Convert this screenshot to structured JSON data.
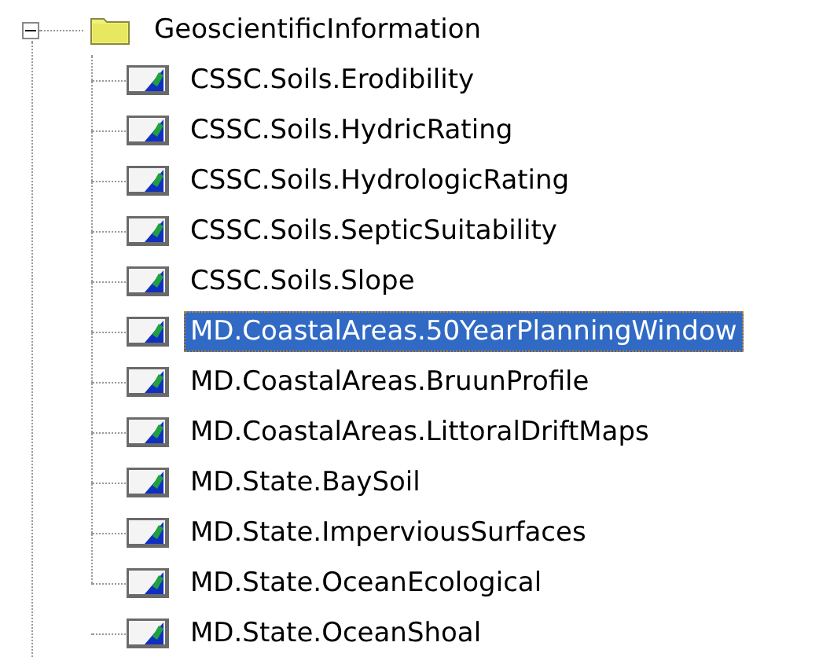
{
  "tree": {
    "label": "GeoscientificInformation",
    "expanded": true,
    "children": [
      {
        "label": "CSSC.Soils.Erodibility",
        "selected": false
      },
      {
        "label": "CSSC.Soils.HydricRating",
        "selected": false
      },
      {
        "label": "CSSC.Soils.HydrologicRating",
        "selected": false
      },
      {
        "label": "CSSC.Soils.SepticSuitability",
        "selected": false
      },
      {
        "label": "CSSC.Soils.Slope",
        "selected": false
      },
      {
        "label": "MD.CoastalAreas.50YearPlanningWindow",
        "selected": true
      },
      {
        "label": "MD.CoastalAreas.BruunProfile",
        "selected": false
      },
      {
        "label": "MD.CoastalAreas.LittoralDriftMaps",
        "selected": false
      },
      {
        "label": "MD.State.BaySoil",
        "selected": false
      },
      {
        "label": "MD.State.ImperviousSurfaces",
        "selected": false
      },
      {
        "label": "MD.State.OceanEcological",
        "selected": false
      },
      {
        "label": "MD.State.OceanShoal",
        "selected": false
      }
    ]
  }
}
